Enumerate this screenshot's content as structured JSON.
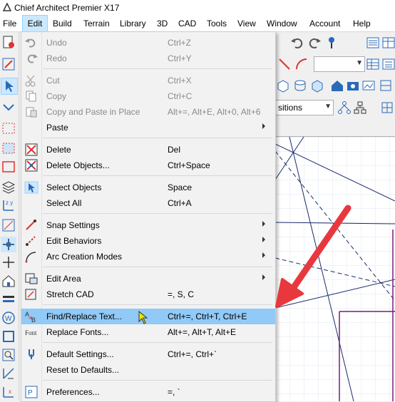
{
  "window": {
    "title": "Chief Architect Premier X17"
  },
  "menubar": {
    "items": [
      "File",
      "Edit",
      "Build",
      "Terrain",
      "Library",
      "3D",
      "CAD",
      "Tools",
      "View",
      "Window",
      "Account",
      "Help"
    ],
    "active": "Edit"
  },
  "toolbar": {
    "layer_combo_value": "sitions"
  },
  "edit_menu": {
    "items": [
      {
        "label": "Undo",
        "shortcut": "Ctrl+Z",
        "enabled": false,
        "icon": "undo-icon"
      },
      {
        "label": "Redo",
        "shortcut": "Ctrl+Y",
        "enabled": false,
        "icon": "redo-icon"
      },
      {
        "label": "Cut",
        "shortcut": "Ctrl+X",
        "enabled": false,
        "icon": "scissors-icon"
      },
      {
        "label": "Copy",
        "shortcut": "Ctrl+C",
        "enabled": false,
        "icon": "copy-icon"
      },
      {
        "label": "Copy and Paste in Place",
        "shortcut": "Alt+=, Alt+E, Alt+0, Alt+6",
        "enabled": false,
        "icon": "paste-in-place-icon"
      },
      {
        "label": "Paste",
        "shortcut": "",
        "enabled": true,
        "submenu": true,
        "icon": ""
      },
      {
        "label": "Delete",
        "shortcut": "Del",
        "enabled": true,
        "icon": "delete-icon"
      },
      {
        "label": "Delete Objects...",
        "shortcut": "Ctrl+Space",
        "enabled": true,
        "icon": "delete-objects-icon"
      },
      {
        "label": "Select Objects",
        "shortcut": "Space",
        "enabled": true,
        "icon": "select-objects-icon"
      },
      {
        "label": "Select All",
        "shortcut": "Ctrl+A",
        "enabled": true,
        "icon": ""
      },
      {
        "label": "Snap Settings",
        "shortcut": "",
        "enabled": true,
        "submenu": true,
        "icon": "snap-icon"
      },
      {
        "label": "Edit Behaviors",
        "shortcut": "",
        "enabled": true,
        "submenu": true,
        "icon": "edit-behaviors-icon"
      },
      {
        "label": "Arc Creation Modes",
        "shortcut": "",
        "enabled": true,
        "submenu": true,
        "icon": "arc-icon"
      },
      {
        "label": "Edit Area",
        "shortcut": "",
        "enabled": true,
        "submenu": true,
        "icon": "edit-area-icon"
      },
      {
        "label": "Stretch CAD",
        "shortcut": "=, S, C",
        "enabled": true,
        "icon": "stretch-cad-icon"
      },
      {
        "label": "Find/Replace Text...",
        "shortcut": "Ctrl+=, Ctrl+T, Ctrl+E",
        "enabled": true,
        "highlighted": true,
        "icon": "find-replace-icon"
      },
      {
        "label": "Replace Fonts...",
        "shortcut": "Alt+=, Alt+T, Alt+E",
        "enabled": true,
        "icon": "font-icon"
      },
      {
        "label": "Default Settings...",
        "shortcut": "Ctrl+=, Ctrl+`",
        "enabled": true,
        "icon": "default-settings-icon"
      },
      {
        "label": "Reset to Defaults...",
        "shortcut": "",
        "enabled": true,
        "icon": ""
      },
      {
        "label": "Preferences...",
        "shortcut": "=, `",
        "enabled": true,
        "icon": "preferences-icon"
      }
    ]
  },
  "colors": {
    "highlight": "#91c9f7",
    "menu_active": "#cce8ff",
    "annotation_arrow": "#e8383d",
    "disabled_text": "#8a8a8a"
  }
}
